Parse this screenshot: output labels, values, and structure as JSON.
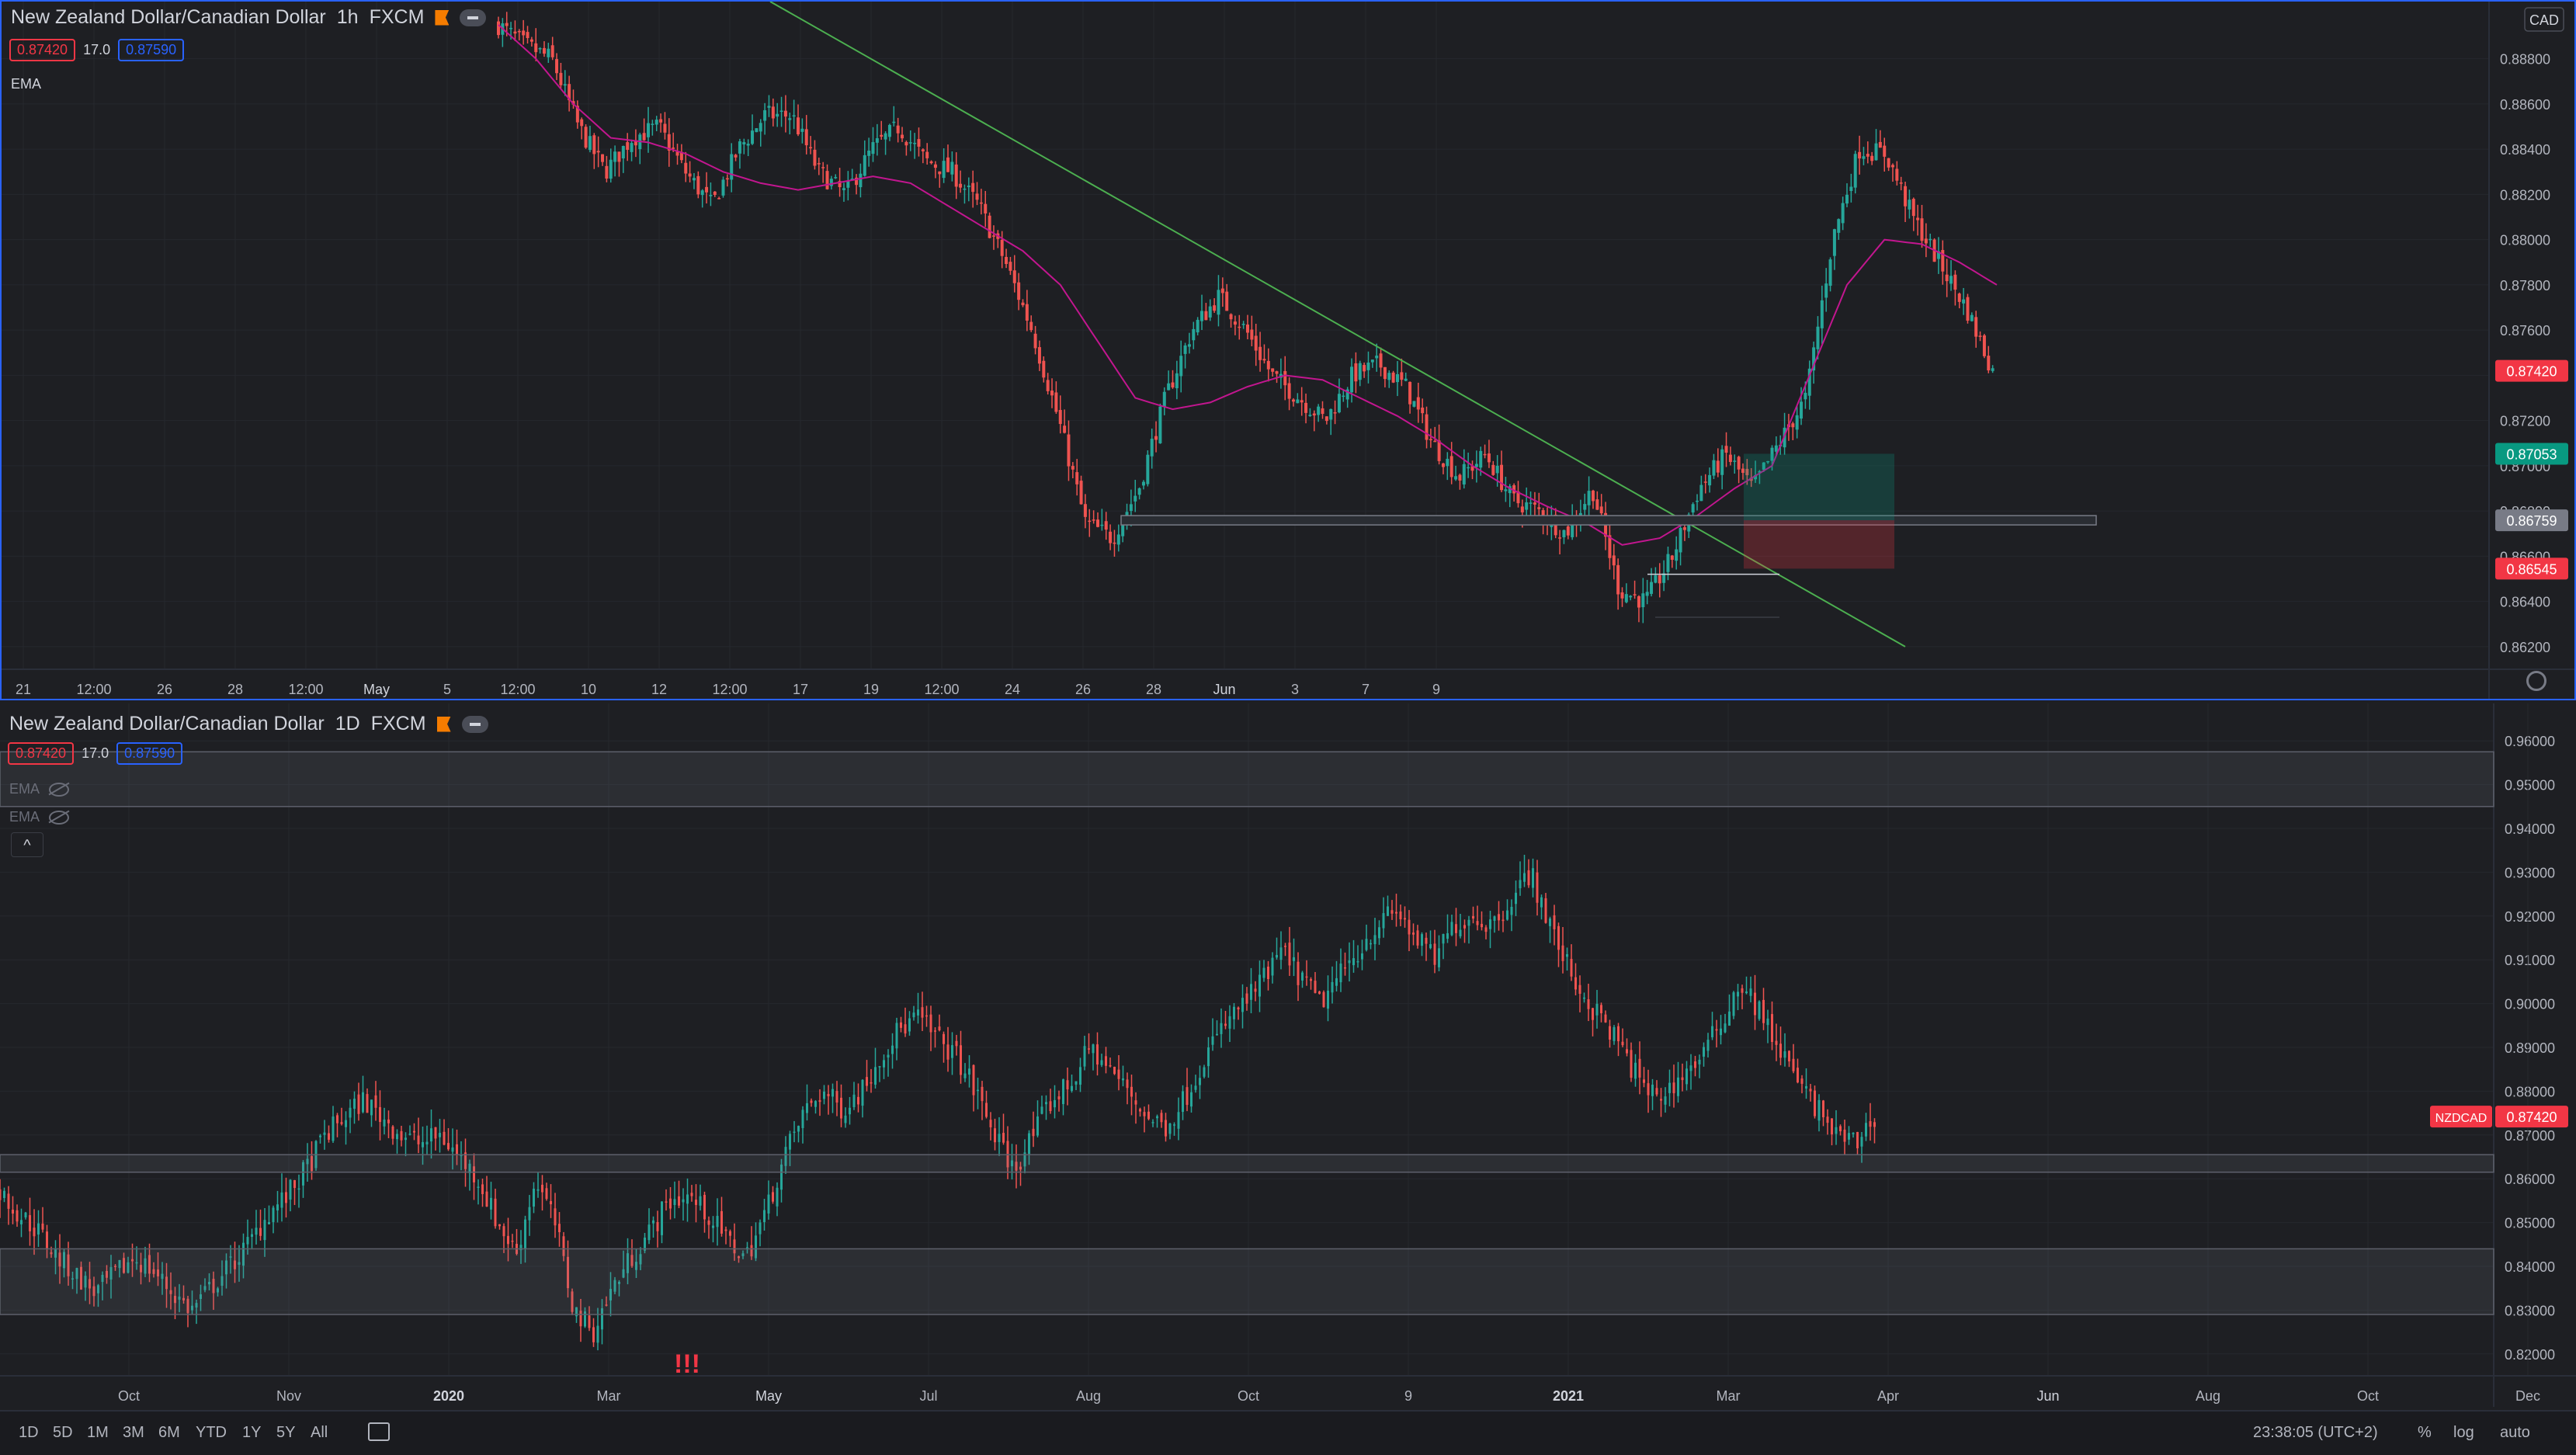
{
  "colors": {
    "up": "#26a69a",
    "down": "#ef5350",
    "ema": "#c2168f",
    "trend": "#4caf50",
    "bg": "#1e1f23",
    "axis_text": "#b2b5be",
    "accent": "#2962ff",
    "alert": "#f23645"
  },
  "top": {
    "title": "New Zealand Dollar/Canadian Dollar",
    "interval": "1h",
    "source": "FXCM",
    "bid": "0.87420",
    "spread": "17.0",
    "ask": "0.87590",
    "indicator": "EMA",
    "currency": "CAD",
    "price_labels": [
      {
        "value": "0.87420",
        "color": "#f23645"
      },
      {
        "value": "0.87053",
        "color": "#089981"
      },
      {
        "value": "0.86759",
        "color": "#787b86"
      },
      {
        "value": "0.86545",
        "color": "#f23645"
      }
    ]
  },
  "bottom": {
    "title": "New Zealand Dollar/Canadian Dollar",
    "interval": "1D",
    "source": "FXCM",
    "bid": "0.87420",
    "spread": "17.0",
    "ask": "0.87590",
    "indicators": [
      "EMA",
      "EMA"
    ],
    "collapse_icon": "chevron-up-icon",
    "symbol_label": "NZDCAD",
    "price_label": "0.87420",
    "annotation": "!!!"
  },
  "toolbar": {
    "timeframes": [
      "1D",
      "5D",
      "1M",
      "3M",
      "6M",
      "YTD",
      "1Y",
      "5Y",
      "All"
    ],
    "clock": "23:38:05 (UTC+2)",
    "percent": "%",
    "log": "log",
    "auto": "auto"
  },
  "chart_data": [
    {
      "type": "candlestick",
      "title": "New Zealand Dollar/Canadian Dollar",
      "interval": "1h",
      "ylim": [
        0.861,
        0.8895
      ],
      "y_ticks": [
        "0.88800",
        "0.88600",
        "0.88400",
        "0.88200",
        "0.88000",
        "0.87800",
        "0.87600",
        "0.87400",
        "0.87200",
        "0.87000",
        "0.86800",
        "0.86600",
        "0.86400",
        "0.86200"
      ],
      "x_ticks": [
        "21",
        "12:00",
        "26",
        "28",
        "12:00",
        "May",
        "5",
        "12:00",
        "10",
        "12",
        "12:00",
        "17",
        "19",
        "12:00",
        "24",
        "26",
        "28",
        "Jun",
        "3",
        "7",
        "9"
      ],
      "close_path": [
        0.8895,
        0.8886,
        0.888,
        0.885,
        0.883,
        0.8845,
        0.885,
        0.883,
        0.8815,
        0.884,
        0.8855,
        0.8855,
        0.883,
        0.882,
        0.884,
        0.885,
        0.8835,
        0.883,
        0.8815,
        0.879,
        0.876,
        0.872,
        0.8675,
        0.8668,
        0.869,
        0.873,
        0.876,
        0.8775,
        0.876,
        0.874,
        0.873,
        0.872,
        0.874,
        0.8745,
        0.8735,
        0.871,
        0.8695,
        0.8705,
        0.8685,
        0.868,
        0.867,
        0.869,
        0.8645,
        0.864,
        0.866,
        0.869,
        0.8705,
        0.869,
        0.871,
        0.873,
        0.88,
        0.884,
        0.8838,
        0.881,
        0.879,
        0.877,
        0.8742
      ],
      "ema_path": [
        0.8895,
        0.888,
        0.886,
        0.8845,
        0.8843,
        0.8838,
        0.883,
        0.8825,
        0.8822,
        0.8825,
        0.8828,
        0.8825,
        0.8815,
        0.8805,
        0.8795,
        0.878,
        0.8755,
        0.873,
        0.8725,
        0.8728,
        0.8735,
        0.874,
        0.8738,
        0.873,
        0.8722,
        0.8712,
        0.87,
        0.869,
        0.8682,
        0.8675,
        0.8665,
        0.8668,
        0.8678,
        0.869,
        0.87,
        0.874,
        0.878,
        0.88,
        0.8798,
        0.879,
        0.878
      ],
      "trendline": [
        [
          0.8895,
          0.8625
        ]
      ],
      "support_level": 0.86759,
      "position": {
        "entry": 0.86759,
        "target": 0.87053,
        "stop": 0.86545
      },
      "series": [
        {
          "name": "EMA"
        }
      ]
    },
    {
      "type": "candlestick",
      "title": "New Zealand Dollar/Canadian Dollar",
      "interval": "1D",
      "ylim": [
        0.815,
        0.965
      ],
      "y_ticks": [
        "0.96000",
        "0.95000",
        "0.94000",
        "0.93000",
        "0.92000",
        "0.91000",
        "0.90000",
        "0.89000",
        "0.88000",
        "0.87000",
        "0.86000",
        "0.85000",
        "0.84000",
        "0.83000",
        "0.82000"
      ],
      "x_ticks": [
        "Oct",
        "Nov",
        "2020",
        "Mar",
        "May",
        "Jul",
        "Aug",
        "Oct",
        "9",
        "2021",
        "Mar",
        "Apr",
        "Jun",
        "Aug",
        "Oct",
        "Dec"
      ],
      "close_path": [
        0.857,
        0.852,
        0.848,
        0.842,
        0.838,
        0.834,
        0.838,
        0.842,
        0.839,
        0.834,
        0.83,
        0.835,
        0.84,
        0.845,
        0.852,
        0.856,
        0.862,
        0.87,
        0.874,
        0.878,
        0.874,
        0.87,
        0.868,
        0.87,
        0.865,
        0.86,
        0.85,
        0.843,
        0.86,
        0.85,
        0.83,
        0.825,
        0.835,
        0.842,
        0.848,
        0.855,
        0.856,
        0.852,
        0.846,
        0.842,
        0.852,
        0.865,
        0.875,
        0.88,
        0.876,
        0.88,
        0.888,
        0.894,
        0.897,
        0.892,
        0.888,
        0.88,
        0.87,
        0.862,
        0.87,
        0.878,
        0.882,
        0.89,
        0.885,
        0.88,
        0.874,
        0.872,
        0.879,
        0.888,
        0.895,
        0.9,
        0.905,
        0.912,
        0.906,
        0.9,
        0.906,
        0.912,
        0.918,
        0.921,
        0.915,
        0.91,
        0.918,
        0.92,
        0.918,
        0.924,
        0.93,
        0.918,
        0.908,
        0.9,
        0.895,
        0.888,
        0.88,
        0.879,
        0.884,
        0.888,
        0.896,
        0.905,
        0.898,
        0.89,
        0.882,
        0.876,
        0.87,
        0.868,
        0.8742
      ],
      "ranges": [
        [
          0.945,
          0.9575
        ],
        [
          0.8615,
          0.8655
        ],
        [
          0.829,
          0.844
        ]
      ]
    }
  ]
}
